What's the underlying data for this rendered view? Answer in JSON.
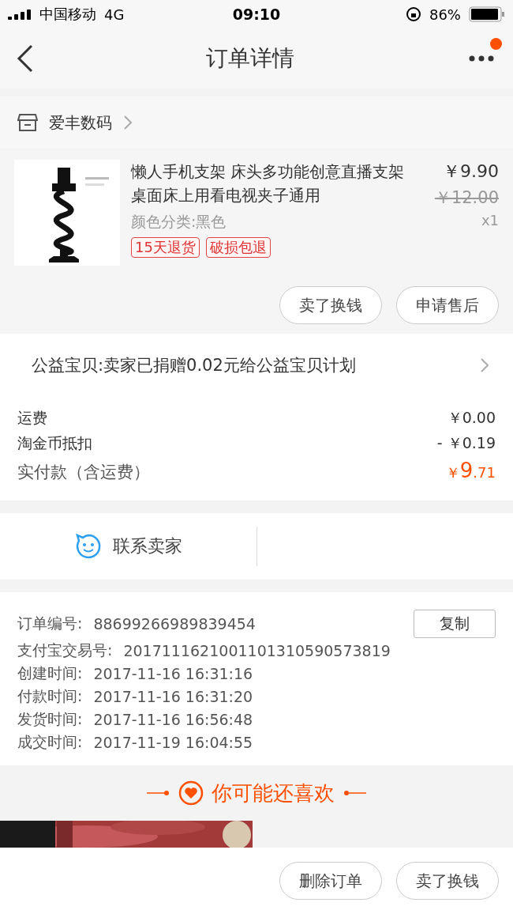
{
  "status_bar": {
    "carrier": "中国移动",
    "network": "4G",
    "time": "09:10",
    "battery": "86%"
  },
  "nav": {
    "title": "订单详情",
    "has_notice": true
  },
  "shop": {
    "name": "爱丰数码"
  },
  "item": {
    "title": "懒人手机支架 床头多功能创意直播支架桌面床上用看电视夹子通用",
    "spec": "颜色分类:黑色",
    "price": "￥9.90",
    "original_price": "￥12.00",
    "quantity": "x1",
    "tags": [
      "15天退货",
      "破损包退"
    ],
    "buttons": [
      "卖了换钱",
      "申请售后"
    ]
  },
  "charity": {
    "text": "公益宝贝:卖家已捐赠0.02元给公益宝贝计划"
  },
  "fees": [
    {
      "label": "运费",
      "value": "￥0.00"
    },
    {
      "label": "淘金币抵扣",
      "value": "- ￥0.19"
    }
  ],
  "total": {
    "label": "实付款（含运费）",
    "currency": "￥",
    "integer": "9",
    "decimal": ".71"
  },
  "contact": {
    "label": "联系卖家"
  },
  "order_info": {
    "rows": [
      {
        "label": "订单编号:",
        "value": "88699266989839454"
      },
      {
        "label": "支付宝交易号:",
        "value": "2017111621001101310590573819"
      },
      {
        "label": "创建时间:",
        "value": "2017-11-16 16:31:16"
      },
      {
        "label": "付款时间:",
        "value": "2017-11-16 16:31:20"
      },
      {
        "label": "发货时间:",
        "value": "2017-11-16 16:56:48"
      },
      {
        "label": "成交时间:",
        "value": "2017-11-19 16:04:55"
      }
    ],
    "copy_button": "复制"
  },
  "recommend": {
    "title": "你可能还喜欢"
  },
  "bottom_buttons": [
    "删除订单",
    "卖了换钱"
  ]
}
